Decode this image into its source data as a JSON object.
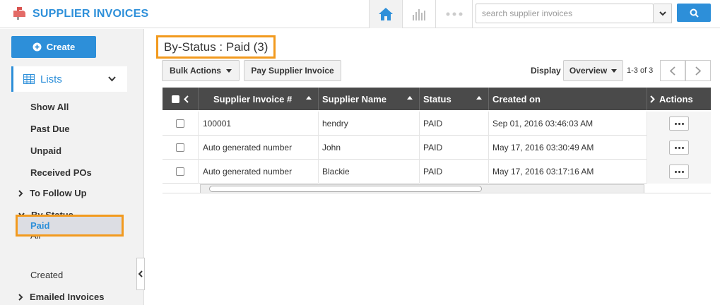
{
  "app": {
    "title": "SUPPLIER INVOICES",
    "brand_color": "#2d8fd9",
    "highlight_color": "#f29a1e"
  },
  "search": {
    "placeholder": "search supplier invoices",
    "value": ""
  },
  "sidebar": {
    "create_label": "Create",
    "lists_label": "Lists",
    "items": [
      {
        "label": "Show All"
      },
      {
        "label": "Past Due"
      },
      {
        "label": "Unpaid"
      },
      {
        "label": "Received POs"
      }
    ],
    "to_follow_up": "To Follow Up",
    "by_status": "By Status",
    "status_items": [
      {
        "label": "All"
      },
      {
        "label": "Paid",
        "selected": true
      },
      {
        "label": "Created"
      }
    ],
    "emailed_invoices": "Emailed Invoices"
  },
  "main": {
    "page_title": "By-Status : Paid (3)",
    "bulk_actions_label": "Bulk Actions",
    "pay_label": "Pay Supplier Invoice",
    "display_label": "Display",
    "display_value": "Overview",
    "range_text": "1-3 of 3"
  },
  "table": {
    "columns": [
      "Supplier Invoice #",
      "Supplier Name",
      "Status",
      "Created on",
      "Actions"
    ],
    "rows": [
      {
        "invoice": "100001",
        "supplier": "hendry",
        "status": "PAID",
        "created": "Sep 01, 2016 03:46:03 AM"
      },
      {
        "invoice": "Auto generated number",
        "supplier": "John",
        "status": "PAID",
        "created": "May 17, 2016 03:30:49 AM"
      },
      {
        "invoice": "Auto generated number",
        "supplier": "Blackie",
        "status": "PAID",
        "created": "May 17, 2016 03:17:16 AM"
      }
    ]
  }
}
